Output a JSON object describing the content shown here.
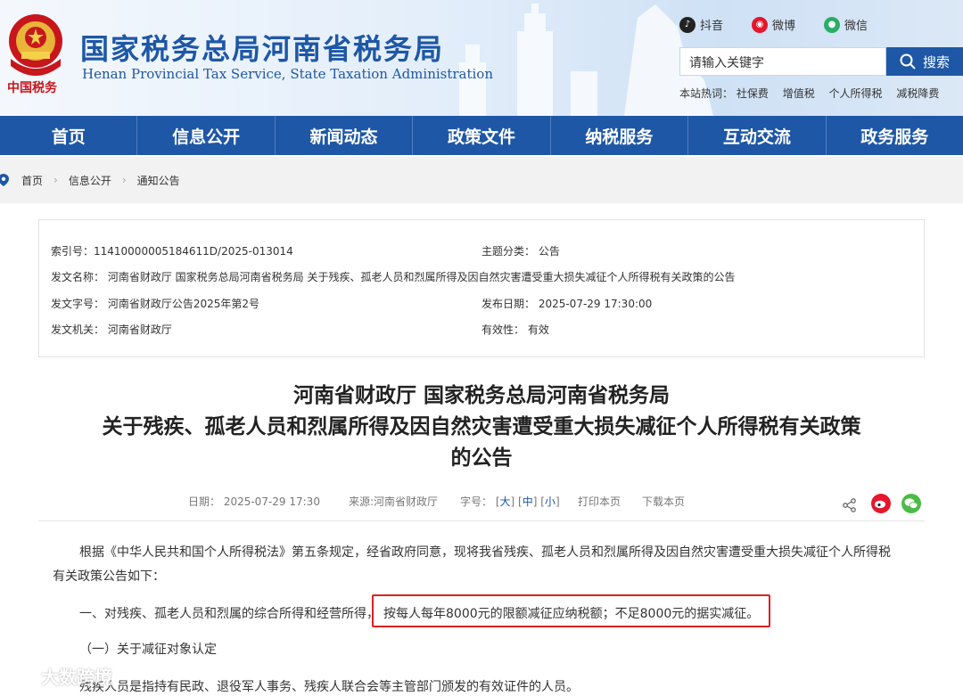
{
  "header": {
    "emblem_text": "中国税务",
    "title": "国家税务总局河南省税务局",
    "subtitle": "Henan Provincial Tax Service, State Taxation Administration",
    "social": [
      {
        "label": "抖音",
        "icon": "douyin-icon",
        "color": "#222222"
      },
      {
        "label": "微博",
        "icon": "weibo-icon",
        "color": "#e6162d"
      },
      {
        "label": "微信",
        "icon": "wechat-icon",
        "color": "#2aae67"
      }
    ],
    "search": {
      "placeholder": "请输入关键字",
      "button": "搜索"
    },
    "hot": {
      "label": "本站热词：",
      "items": [
        "社保费",
        "增值税",
        "个人所得税",
        "减税降费"
      ]
    }
  },
  "nav": [
    "首页",
    "信息公开",
    "新闻动态",
    "政策文件",
    "纳税服务",
    "互动交流",
    "政务服务"
  ],
  "breadcrumb": [
    "首页",
    "信息公开",
    "通知公告"
  ],
  "info": {
    "index_no": "索引号：11410000005184611D/2025-013014",
    "topic": "主题分类：  公告",
    "doc_name": "发文名称：  河南省财政厅 国家税务总局河南省税务局 关于残疾、孤老人员和烈属所得及因自然灾害遭受重大损失减征个人所得税有关政策的公告",
    "doc_no": "发文字号：  河南省财政厅公告2025年第2号",
    "pub_date": "发布日期：  2025-07-29 17:30:00",
    "issuer": "发文机关：  河南省财政厅",
    "validity": "有效性：   有效"
  },
  "article": {
    "title_lines": [
      "河南省财政厅 国家税务总局河南省税务局",
      "关于残疾、孤老人员和烈属所得及因自然灾害遭受重大损失减征个人所得税有关政策",
      "的公告"
    ],
    "date": "日期：  2025-07-29 17:30",
    "source": "来源:河南省财政厅",
    "font_label": "字号：",
    "font_sizes": [
      "大",
      "中",
      "小"
    ],
    "print": "打印本页",
    "download": "下载本页",
    "para1_line1": "根据《中华人民共和国个人所得税法》第五条规定，经省政府同意，现将我省残疾、孤老人员和烈属所得及因自然灾害遭受重大损失减征个人所得税",
    "para1_line2": "有关政策公告如下：",
    "para2_prefix": "一、对残疾、孤老人员和烈属的综合所得和经营所得，",
    "para2_highlight": "按每人每年8000元的限额减征应纳税额；不足8000元的据实减征。",
    "para3": "（一）关于减征对象认定",
    "para4": "残疾人员是指持有民政、退役军人事务、残疾人联合会等主管部门颁发的有效证件的人员。"
  },
  "watermark": "大数跨境",
  "colors": {
    "brand_blue": "#1e57a6",
    "highlight_red": "#e02020"
  }
}
